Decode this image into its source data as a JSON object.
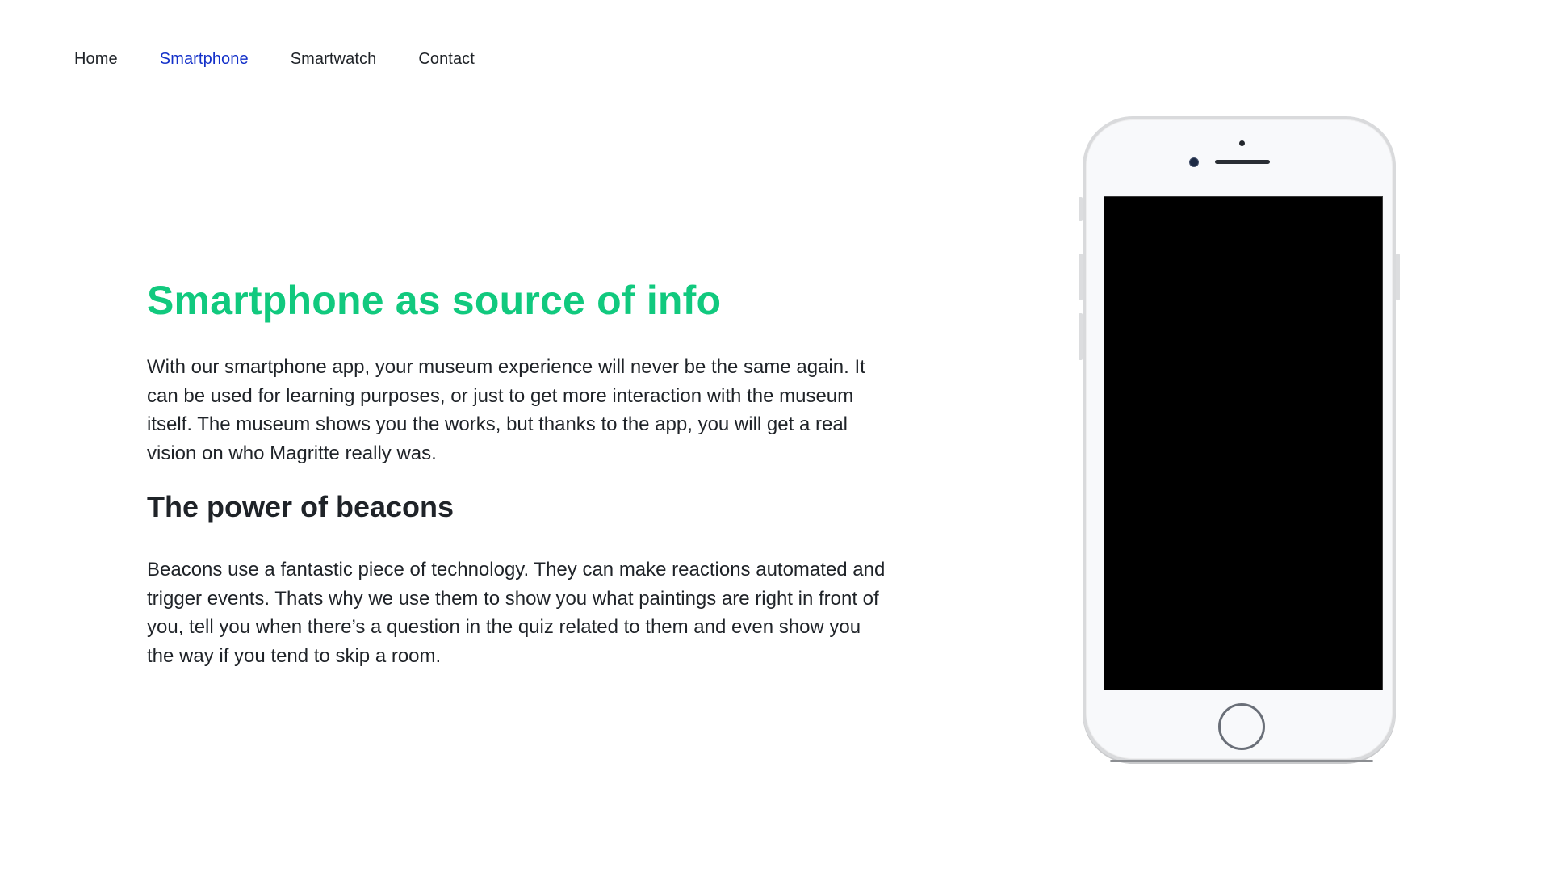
{
  "nav": {
    "items": [
      {
        "label": "Home",
        "active": false
      },
      {
        "label": "Smartphone",
        "active": true
      },
      {
        "label": "Smartwatch",
        "active": false
      },
      {
        "label": "Contact",
        "active": false
      }
    ]
  },
  "main": {
    "title": "Smartphone as source of info",
    "intro": "With our smartphone app, your museum experience will never be the same again. It can be used for learning purposes, or just to get more interaction with the museum itself. The museum shows you the works, but thanks to the app, you will get a real vision on who Magritte really was.",
    "subtitle": "The power of beacons",
    "beacons_text": "Beacons use a fantastic piece of technology. They can make reactions automated and trigger events. Thats why we use them to show you what paintings are right in front of you, tell you when there’s a question in the quiz related to them and even show you the way if you tend to skip a room."
  },
  "colors": {
    "accent_green": "#11c97e",
    "active_nav_blue": "#1330c9",
    "text_dark": "#1f2328"
  },
  "icons": {
    "device": "smartphone-mockup"
  }
}
